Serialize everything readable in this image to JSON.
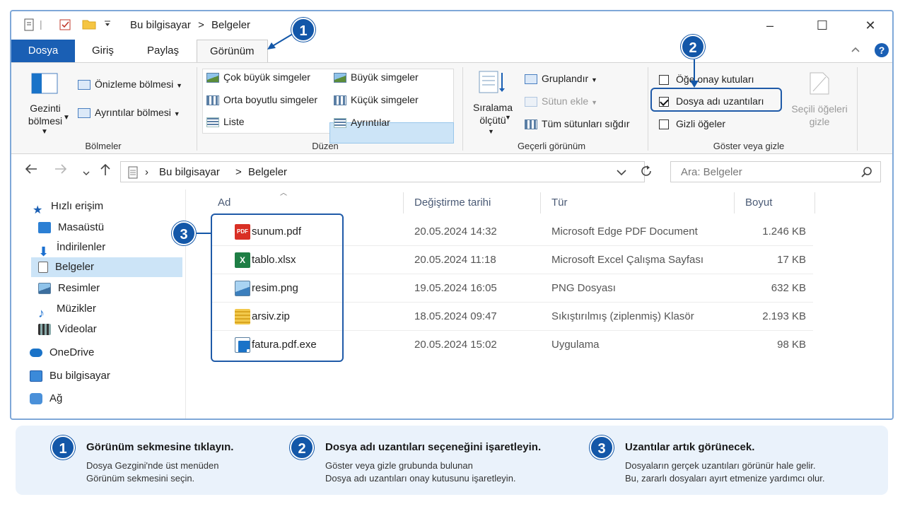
{
  "titlebar": {
    "path": [
      "Bu bilgisayar",
      ">",
      "Belgeler"
    ],
    "minimize": "–",
    "maximize": "☐",
    "close": "✕"
  },
  "tabs": [
    {
      "label": "Dosya"
    },
    {
      "label": "Giriş"
    },
    {
      "label": "Paylaş"
    },
    {
      "label": "Görünüm"
    }
  ],
  "ribbon": {
    "panes": {
      "nav_pane": "Gezinti bölmesi",
      "preview_pane": "Önizleme bölmesi",
      "details_pane": "Ayrıntılar bölmesi",
      "label": "Bölmeler"
    },
    "layout": {
      "items": [
        "Çok büyük simgeler",
        "Büyük simgeler",
        "Orta boyutlu simgeler",
        "Küçük simgeler",
        "Liste",
        "Ayrıntılar"
      ],
      "label": "Düzen"
    },
    "current_view": {
      "sort": "Sıralama ölçütü",
      "group": "Gruplandır",
      "add_column": "Sütun ekle",
      "fit_columns": "Tüm sütunları sığdır",
      "label": "Geçerli görünüm"
    },
    "show_hide": {
      "item_checkboxes": "Öğe onay kutuları",
      "file_extensions": "Dosya adı uzantıları",
      "hidden_items": "Gizli öğeler",
      "hide_selected": "Seçili öğeleri gizle",
      "label": "Göster veya gizle"
    }
  },
  "address": {
    "path": [
      "Bu bilgisayar",
      ">",
      "Belgeler"
    ],
    "search_placeholder": "Ara: Belgeler"
  },
  "nav": {
    "items": [
      "Hızlı erişim",
      "Masaüstü",
      "İndirilenler",
      "Belgeler",
      "Resimler",
      "Müzikler",
      "Videolar",
      "OneDrive",
      "Bu bilgisayar",
      "Ağ"
    ]
  },
  "columns": [
    "Ad",
    "Değiştirme tarihi",
    "Tür",
    "Boyut"
  ],
  "files": [
    {
      "name": "sunum.pdf",
      "date": "20.05.2024 14:32",
      "type": "Microsoft Edge PDF Document",
      "size": "1.246 KB"
    },
    {
      "name": "tablo.xlsx",
      "date": "20.05.2024 11:18",
      "type": "Microsoft Excel Çalışma Sayfası",
      "size": "17 KB"
    },
    {
      "name": "resim.png",
      "date": "19.05.2024 16:05",
      "type": "PNG Dosyası",
      "size": "632 KB"
    },
    {
      "name": "arsiv.zip",
      "date": "18.05.2024 09:47",
      "type": "Sıkıştırılmış (ziplenmiş) Klasör",
      "size": "2.193 KB"
    },
    {
      "name": "fatura.pdf.exe",
      "date": "20.05.2024 15:02",
      "type": "Uygulama",
      "size": "98 KB"
    }
  ],
  "pdf_icon_text": "PDF",
  "xls_icon_text": "X",
  "badges": [
    "1",
    "2",
    "3"
  ],
  "steps": [
    {
      "num": "1",
      "title": "Görünüm sekmesine tıklayın.",
      "desc1": "Dosya Gezgini'nde üst menüden",
      "desc2": "Görünüm sekmesini seçin."
    },
    {
      "num": "2",
      "title": "Dosya adı uzantıları seçeneğini işaretleyin.",
      "desc1": "Göster veya gizle grubunda bulunan",
      "desc2": "Dosya adı uzantıları onay kutusunu işaretleyin."
    },
    {
      "num": "3",
      "title": "Uzantılar artık görünecek.",
      "desc1": "Dosyaların gerçek uzantıları görünür hale gelir.",
      "desc2": "Bu, zararlı dosyaları ayırt etmenize yardımcı olur."
    }
  ],
  "colors": {
    "accent": "#1357a8",
    "file_tab": "#1a5fb4",
    "selection": "#cce4f7"
  }
}
